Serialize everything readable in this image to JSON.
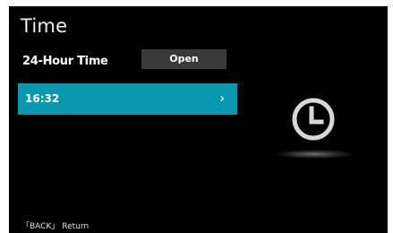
{
  "header": {
    "title": "Time"
  },
  "setting": {
    "label": "24-Hour Time",
    "button_label": "Open"
  },
  "time_item": {
    "value": "16:32",
    "chevron": "›"
  },
  "illustration": {
    "icon": "clock-icon"
  },
  "footer": {
    "hint": "「BACK」 Return"
  },
  "colors": {
    "background": "#000000",
    "highlight": "#0898ae",
    "button": "#3a3a3a",
    "text": "#ffffff"
  }
}
